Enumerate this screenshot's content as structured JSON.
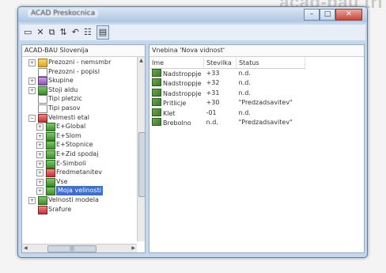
{
  "corner_text": "acad-bau tri",
  "window": {
    "title": "ACAD Preskocnica"
  },
  "window_buttons": {
    "minimize": "–",
    "maximize": "□",
    "close": "✕"
  },
  "toolbar": {
    "icons": [
      "folder-icon",
      "delete-icon",
      "copy-icon",
      "sort-icon",
      "undo-icon",
      "list-view-icon",
      "details-view-icon"
    ],
    "glyphs": [
      "▭",
      "✕",
      "⧉",
      "⇅",
      "↶",
      "☷",
      "▤"
    ]
  },
  "left_pane": {
    "header": "ACAD-BAU Slovenija",
    "tree": [
      {
        "label": "Prezozni - nemsmbr",
        "indent": 1,
        "expand": "+",
        "icon": "folder"
      },
      {
        "label": "Prezozni - popisl",
        "indent": 1,
        "expand": "",
        "icon": "doc"
      },
      {
        "label": "Skupine",
        "indent": 1,
        "expand": "+",
        "icon": "block"
      },
      {
        "label": "Stoji aldu",
        "indent": 1,
        "expand": "+",
        "icon": "green"
      },
      {
        "label": "Tipi pletzic",
        "indent": 1,
        "expand": "",
        "icon": "doc"
      },
      {
        "label": "Tipi pasov",
        "indent": 1,
        "expand": "",
        "icon": "doc"
      },
      {
        "label": "Velmesti etal",
        "indent": 1,
        "expand": "−",
        "icon": "red"
      },
      {
        "label": "E+Global",
        "indent": 2,
        "expand": "+",
        "icon": "green"
      },
      {
        "label": "E+Slom",
        "indent": 2,
        "expand": "+",
        "icon": "green"
      },
      {
        "label": "E+Stopnice",
        "indent": 2,
        "expand": "+",
        "icon": "green"
      },
      {
        "label": "E+Zid spodaj",
        "indent": 2,
        "expand": "+",
        "icon": "green"
      },
      {
        "label": "E-Simboli",
        "indent": 2,
        "expand": "+",
        "icon": "green"
      },
      {
        "label": "Fredmetanitev",
        "indent": 2,
        "expand": "+",
        "icon": "red"
      },
      {
        "label": "Vse",
        "indent": 2,
        "expand": "+",
        "icon": "green"
      },
      {
        "label": "Moja velinosti",
        "indent": 2,
        "expand": "+",
        "icon": "green",
        "selected": true
      },
      {
        "label": "Velnosti modela",
        "indent": 1,
        "expand": "+",
        "icon": "green"
      },
      {
        "label": "Srafure",
        "indent": 1,
        "expand": "",
        "icon": "red"
      }
    ]
  },
  "right_pane": {
    "header": "Vnebina 'Nova vidnost'",
    "columns": [
      "Ime",
      "Stevilka",
      "Status"
    ],
    "rows": [
      {
        "name": "Nadstroppje",
        "number": "+33",
        "status": "n.d."
      },
      {
        "name": "Nadstroppje",
        "number": "+32",
        "status": "n.d."
      },
      {
        "name": "Nadstroppje",
        "number": "+31",
        "status": "n.d."
      },
      {
        "name": "Pritlicje",
        "number": "+30",
        "status": "\"Predzadsavitev\""
      },
      {
        "name": "Klet",
        "number": "-01",
        "status": "n.d."
      },
      {
        "name": "Brebolno",
        "number": "n.d.",
        "status": "\"Predzadsavitev\""
      }
    ]
  },
  "colors": {
    "selection": "#3a6fd8",
    "frame": "#c4d7ec"
  }
}
